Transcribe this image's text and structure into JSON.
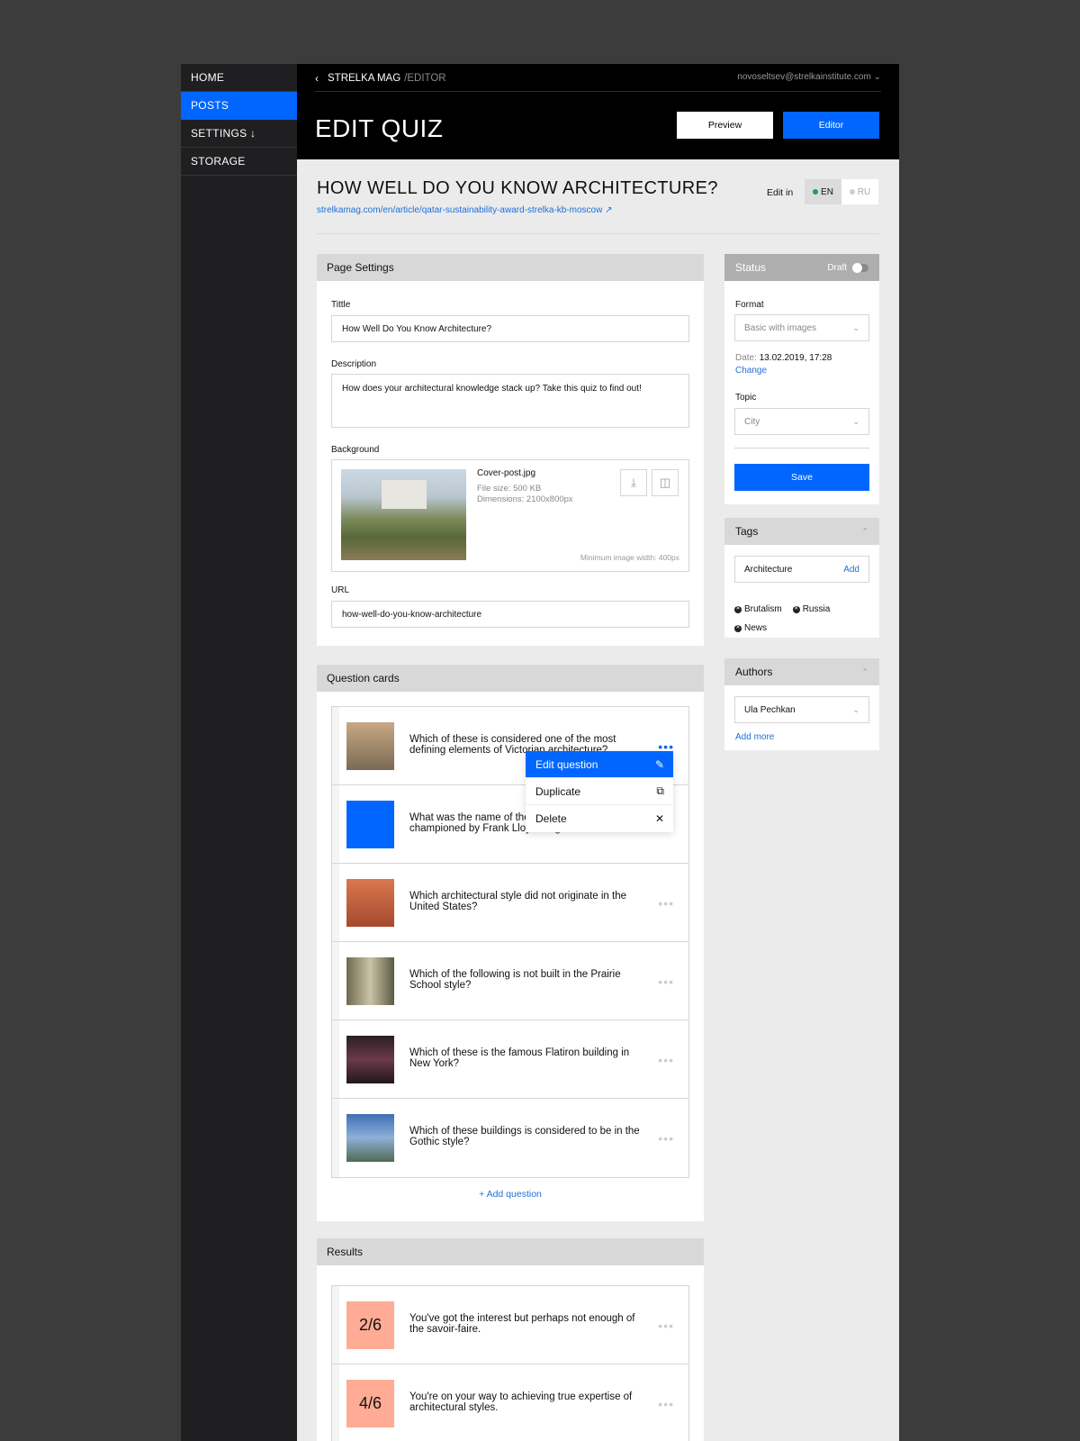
{
  "sidebar": {
    "items": [
      {
        "label": "HOME"
      },
      {
        "label": "POSTS"
      },
      {
        "label": "SETTINGS ↓"
      },
      {
        "label": "STORAGE"
      }
    ]
  },
  "header": {
    "brand": "STRELKA MAG",
    "section": "/EDITOR",
    "user_email": "novoseltsev@strelkainstitute.com",
    "page_title": "EDIT QUIZ",
    "preview_label": "Preview",
    "editor_label": "Editor"
  },
  "quiz": {
    "title": "HOW WELL DO YOU KNOW ARCHITECTURE?",
    "link": "strelkamag.com/en/article/qatar-sustainability-award-strelka-kb-moscow",
    "edit_in_label": "Edit in",
    "lang_en": "EN",
    "lang_ru": "RU"
  },
  "page_settings": {
    "heading": "Page Settings",
    "title_label": "Tittle",
    "title_value": "How Well Do You Know Architecture?",
    "description_label": "Description",
    "description_value": "How does your architectural knowledge stack up? Take this quiz to find out!",
    "background_label": "Background",
    "file_name": "Cover-post.jpg",
    "file_size": "File size: 500 KB",
    "dimensions": "Dimensions: 2100x800px",
    "min_width": "Minimum image width: 400px",
    "url_label": "URL",
    "url_value": "how-well-do-you-know-architecture"
  },
  "questions": {
    "heading": "Question cards",
    "items": [
      {
        "text": "Which of these is considered one of the most defining elements of Victorian architecture?"
      },
      {
        "text": "What was the name of the architectural style championed by Frank Lloyd Wright?"
      },
      {
        "text": "Which architectural style did not originate in the United States?"
      },
      {
        "text": "Which of the following is not built in the Prairie School style?"
      },
      {
        "text": "Which of these is the famous Flatiron building in New York?"
      },
      {
        "text": "Which of these buildings is considered to be in the Gothic style?"
      }
    ],
    "add_label": "Add question"
  },
  "context_menu": {
    "edit": "Edit question",
    "duplicate": "Duplicate",
    "delete": "Delete"
  },
  "results": {
    "heading": "Results",
    "items": [
      {
        "score": "2/6",
        "text": "You've got the interest but perhaps not enough of the savoir-faire."
      },
      {
        "score": "4/6",
        "text": "You're on your way to achieving true expertise of architectural styles."
      }
    ]
  },
  "status": {
    "heading": "Status",
    "toggle_label": "Draft",
    "format_label": "Format",
    "format_value": "Basic with images",
    "date_label": "Date:",
    "date_value": "13.02.2019, 17:28",
    "change_label": "Change",
    "topic_label": "Topic",
    "topic_value": "City",
    "save_label": "Save"
  },
  "tags": {
    "heading": "Tags",
    "input_value": "Architecture",
    "add_label": "Add",
    "items": [
      "Brutalism",
      "Russia",
      "News"
    ]
  },
  "authors": {
    "heading": "Authors",
    "selected": "Ula Pechkan",
    "add_more": "Add more"
  },
  "colors": {
    "accent": "#0066ff",
    "result_badge": "#ffab95",
    "topbar": "#000000"
  }
}
